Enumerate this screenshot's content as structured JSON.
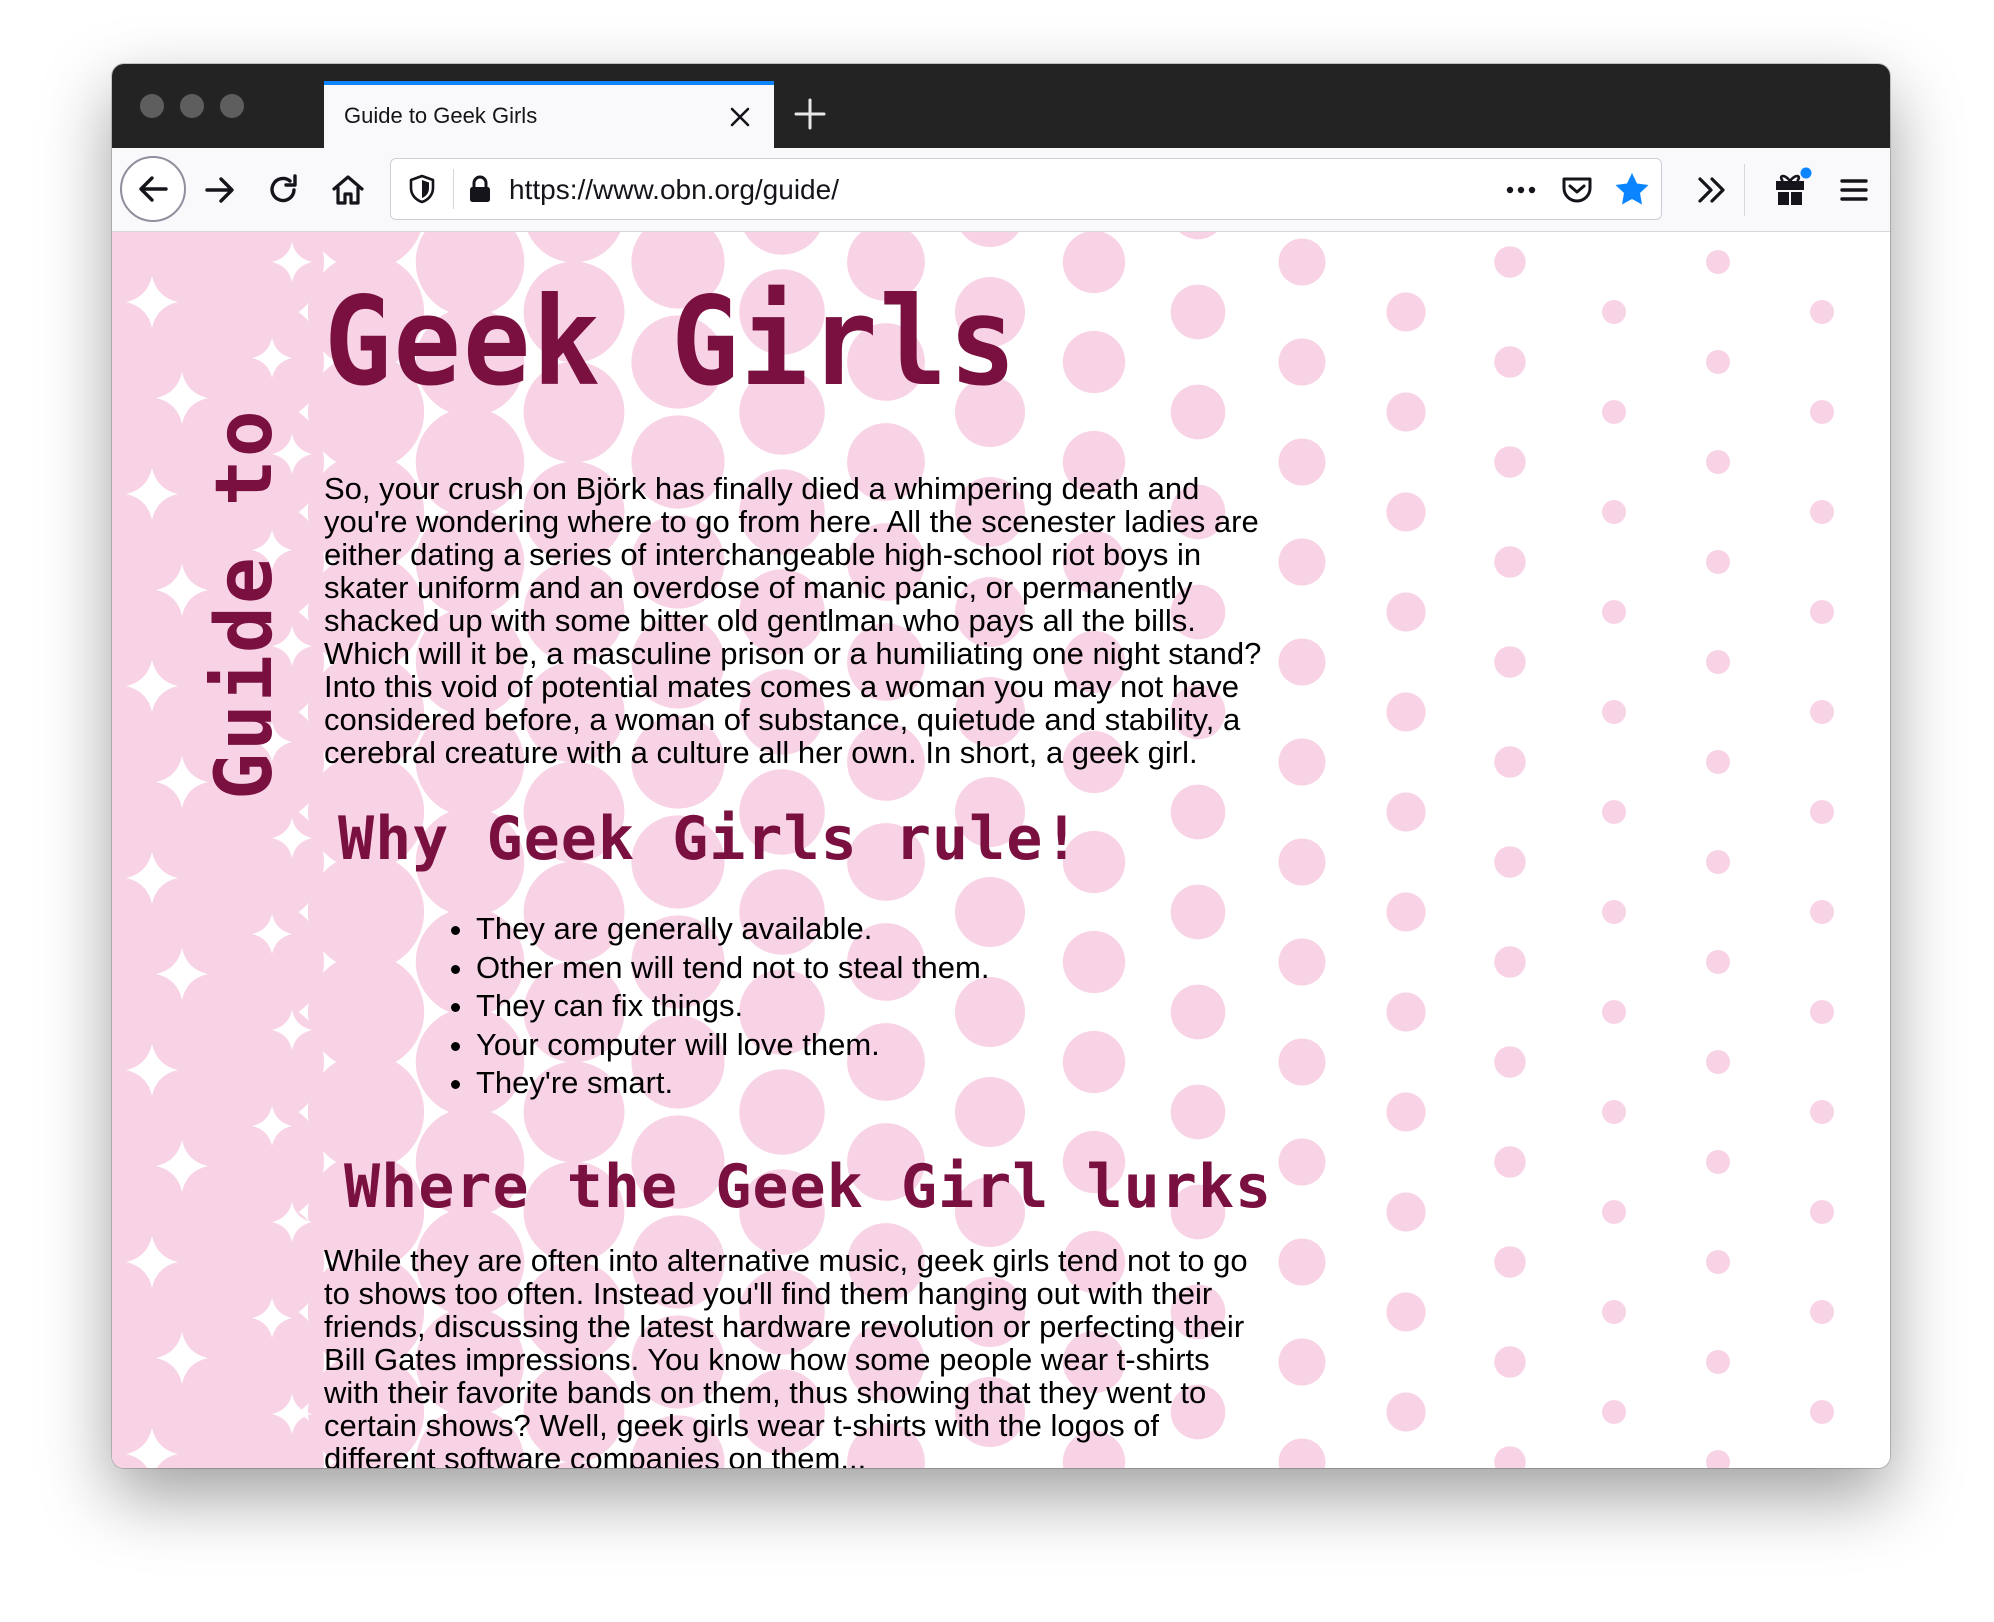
{
  "browser": {
    "tab": {
      "title": "Guide to Geek Girls"
    },
    "url": "https://www.obn.org/guide/",
    "icons": {
      "back": "back-arrow-icon",
      "forward": "forward-arrow-icon",
      "reload": "reload-icon",
      "home": "home-icon",
      "tracking": "shield-icon",
      "secure": "lock-icon",
      "page_actions": "more-icon",
      "pocket": "pocket-icon",
      "bookmark": "star-icon",
      "overflow": "chevron-double-right-icon",
      "whats_new": "gift-icon",
      "menu": "hamburger-menu-icon"
    },
    "colors": {
      "tab_accent": "#0a84ff",
      "bookmark_star": "#0a84ff",
      "tabstrip": "#232323"
    }
  },
  "page": {
    "side_label": "Guide to",
    "title": "Geek Girls",
    "intro": "So, your crush on Björk has finally died a whimpering death and you're wondering where to go from here. All the scenester ladies are either dating a series of interchangeable high-school riot boys in skater uniform and an overdose of manic panic, or permanently shacked up with some bitter old gentlman who pays all the bills. Which will it be, a masculine prison or a humiliating one night stand? Into this void of potential mates comes a woman you may not have considered before, a woman of substance, quietude and stability, a cerebral creature with a culture all her own. In short, a geek girl.",
    "section1": {
      "heading": "Why Geek Girls rule!",
      "items": [
        "They are generally available.",
        "Other men will tend not to steal them.",
        "They can fix things.",
        "Your computer will love them.",
        "They're smart."
      ]
    },
    "section2": {
      "heading": "Where the Geek Girl lurks",
      "text": "While they are often into alternative music, geek girls tend not to go to shows too often. Instead you'll find them hanging out with their friends, discussing the latest hardware revolution or perfecting their Bill Gates impressions. You know how some people wear t-shirts with their favorite bands on them, thus showing that they went to certain shows? Well, geek girls wear t-shirts with the logos of different software companies on them..."
    },
    "colors": {
      "heading": "#7a1040",
      "dots": "#f8d3e5",
      "text": "#000000"
    }
  }
}
